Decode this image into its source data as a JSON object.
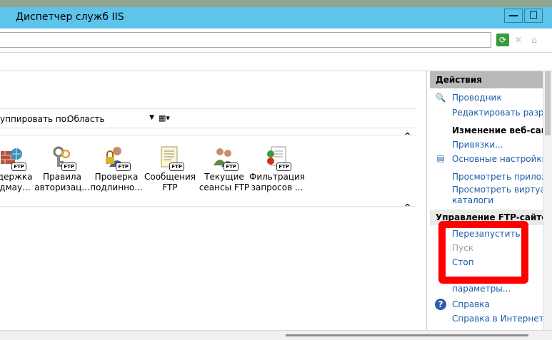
{
  "window": {
    "title": "Диспетчер служб IIS",
    "controls": {
      "minimize": "—",
      "maximize": "☐"
    }
  },
  "group_bar": {
    "label": "уппировать по:",
    "value": "Область"
  },
  "features": [
    {
      "name": "ftp-support-feature",
      "line1": "ддержка",
      "line2": "ндмау...",
      "icon": "globe-brick-icon"
    },
    {
      "name": "ftp-authorization-feature",
      "line1": "Правила",
      "line2": "авторизац...",
      "icon": "key-icon"
    },
    {
      "name": "ftp-authentication-feature",
      "line1": "Проверка",
      "line2": "подлинно...",
      "icon": "user-lock-icon"
    },
    {
      "name": "ftp-messages-feature",
      "line1": "Сообщения",
      "line2": "FTP",
      "icon": "document-icon"
    },
    {
      "name": "ftp-sessions-feature",
      "line1": "Текущие",
      "line2": "сеансы FTP",
      "icon": "users-icon"
    },
    {
      "name": "ftp-filtering-feature",
      "line1": "Фильтрация",
      "line2": "запросов ...",
      "icon": "filter-icon"
    }
  ],
  "ftp_badge": "FTP",
  "actions": {
    "header": "Действия",
    "explore": "Проводник",
    "edit_permissions": "Редактировать разреш",
    "edit_site_title": "Изменение веб-сайта",
    "bindings": "Привязки...",
    "basic_settings": "Основные настройки...",
    "view_apps": "Просмотреть приложе",
    "view_virtual_1": "Просмотреть виртуаль",
    "view_virtual_2": "каталоги",
    "manage_ftp": "Управление FTP-сайтом",
    "restart": "Перезапустить",
    "start": "Пуск",
    "stop": "Стоп",
    "advanced": "параметры...",
    "help": "Справка",
    "online_help": "Справка в Интернете"
  },
  "colors": {
    "titlebar": "#5dc4eb",
    "link": "#1a5aa8",
    "highlight": "#ff0000"
  }
}
